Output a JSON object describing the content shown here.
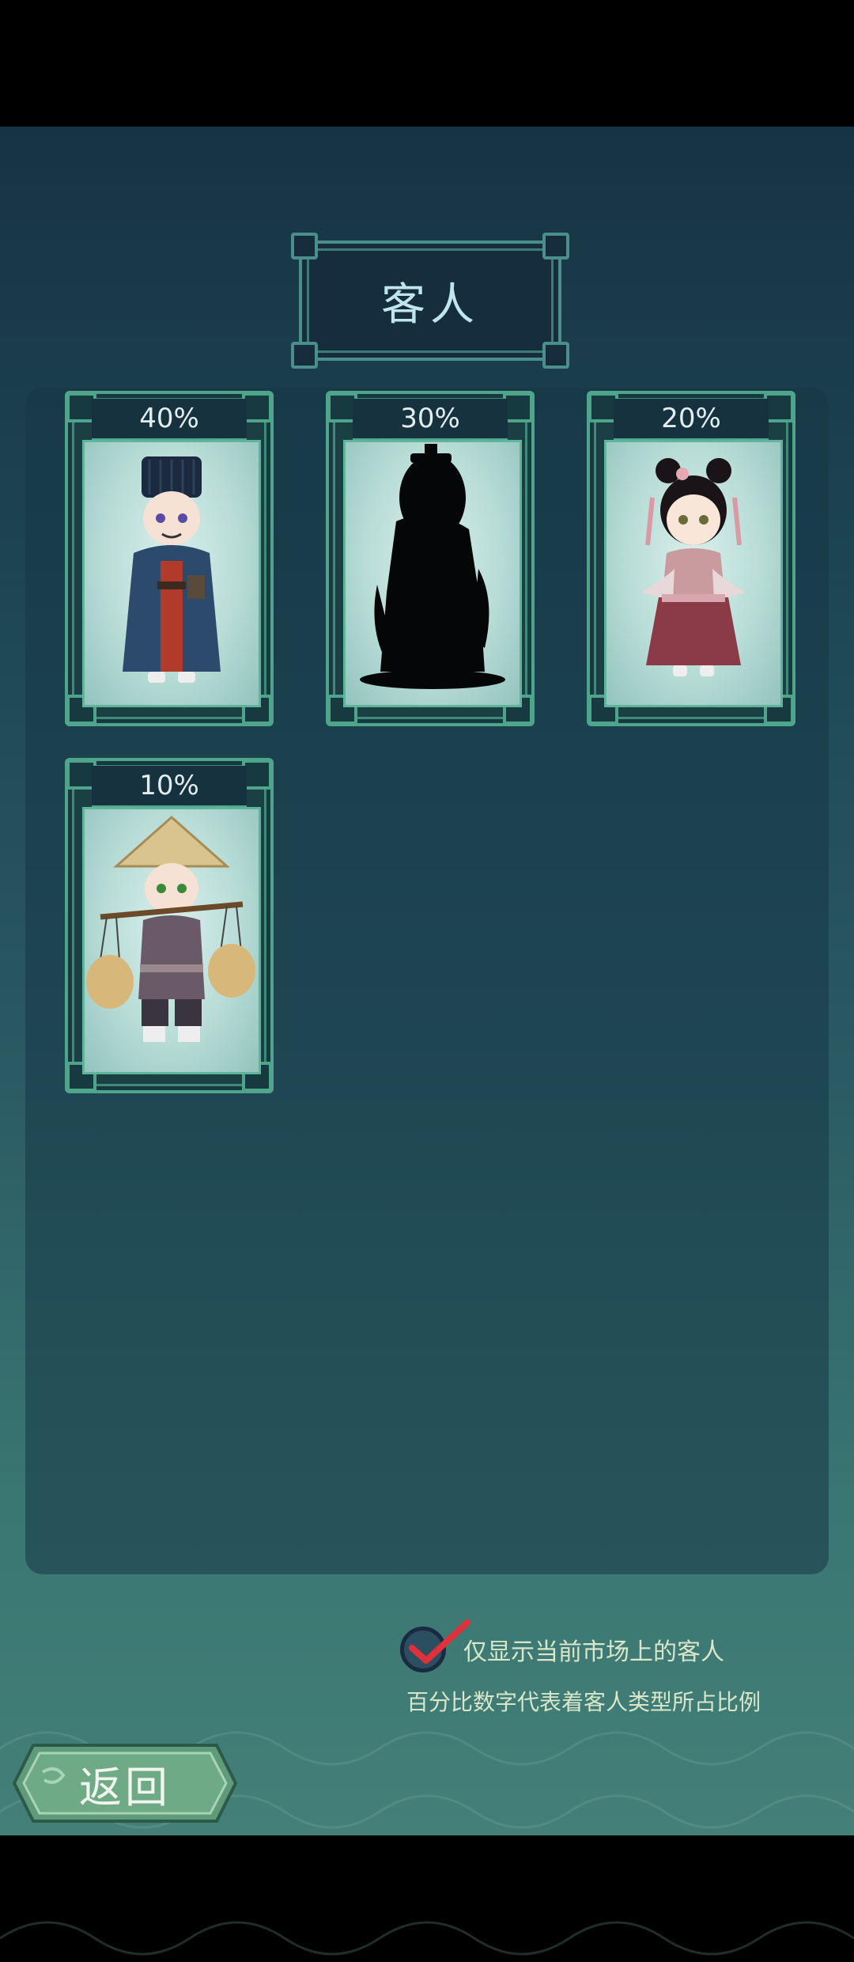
{
  "title": "客人",
  "customers": [
    {
      "name": "official",
      "percentage": "40%",
      "revealed": true
    },
    {
      "name": "unknown-silhouette",
      "percentage": "30%",
      "revealed": false
    },
    {
      "name": "maiden",
      "percentage": "20%",
      "revealed": true
    },
    {
      "name": "peddler",
      "percentage": "10%",
      "revealed": true
    }
  ],
  "filter": {
    "label": "仅显示当前市场上的客人",
    "checked": true
  },
  "note": "百分比数字代表着客人类型所占比例",
  "back_button": {
    "label": "返回"
  },
  "colors": {
    "accent": "#4fa58c",
    "check": "#e0303c",
    "background": "#1d4453"
  }
}
